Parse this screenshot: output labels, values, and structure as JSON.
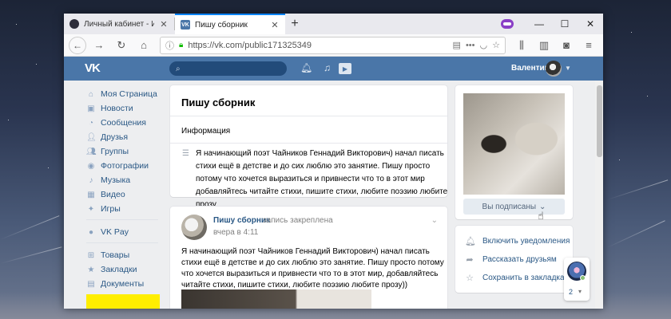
{
  "browser": {
    "tabs": [
      {
        "label": "Личный кабинет - Исполните",
        "active": false,
        "favicon": "account-circle-icon"
      },
      {
        "label": "Пишу сборник",
        "active": true,
        "favicon": "vk-icon"
      }
    ],
    "new_tab_label": "+",
    "url": "https://vk.com/public171325349",
    "accent": "#0a84ff"
  },
  "vk": {
    "brand_color": "#4a76a8",
    "logo_text": "VK",
    "search_placeholder": "",
    "user_name": "Валентин",
    "sidebar": [
      {
        "label": "Моя Страница",
        "icon": "home-icon"
      },
      {
        "label": "Новости",
        "icon": "news-icon"
      },
      {
        "label": "Сообщения",
        "icon": "message-icon"
      },
      {
        "label": "Друзья",
        "icon": "friend-icon"
      },
      {
        "label": "Группы",
        "icon": "groups-icon"
      },
      {
        "label": "Фотографии",
        "icon": "camera-icon"
      },
      {
        "label": "Музыка",
        "icon": "music-icon"
      },
      {
        "label": "Видео",
        "icon": "video-icon"
      },
      {
        "label": "Игры",
        "icon": "game-icon"
      }
    ],
    "sidebar_pay": "VK Pay",
    "sidebar_more": [
      {
        "label": "Товары",
        "icon": "goods-icon"
      },
      {
        "label": "Закладки",
        "icon": "bookmark-icon"
      },
      {
        "label": "Документы",
        "icon": "document-icon"
      }
    ],
    "group": {
      "title": "Пишу сборник",
      "info_label": "Информация",
      "description": "Я начинающий поэт Чайников Геннадий Викторович) начал писать стихи ещё в детстве и до сих люблю это занятие. Пишу просто потому что хочется выразиться и привнести что то в этот мир добавляйтесь читайте стихи, пишите стихи, любите поэзию любите прозу"
    },
    "post": {
      "author": "Пишу сборник",
      "pinned": "запись закреплена",
      "date": "вчера в 4:11",
      "text": "Я начинающий поэт Чайников Геннадий Викторович) начал писать стихи ещё в детстве и до сих люблю это занятие. Пишу просто потому что хочется выразиться и привнести что то в этот мир, добавляйтесь читайте стихи, пишите стихи, любите поэзию любите прозу))"
    },
    "right": {
      "subscribed_label": "Вы подписаны",
      "actions": [
        {
          "label": "Включить уведомления",
          "icon": "bell-icon"
        },
        {
          "label": "Рассказать друзьям",
          "icon": "share-icon"
        },
        {
          "label": "Сохранить в закладках",
          "icon": "star-icon"
        }
      ]
    },
    "chat": {
      "count": "2"
    }
  }
}
